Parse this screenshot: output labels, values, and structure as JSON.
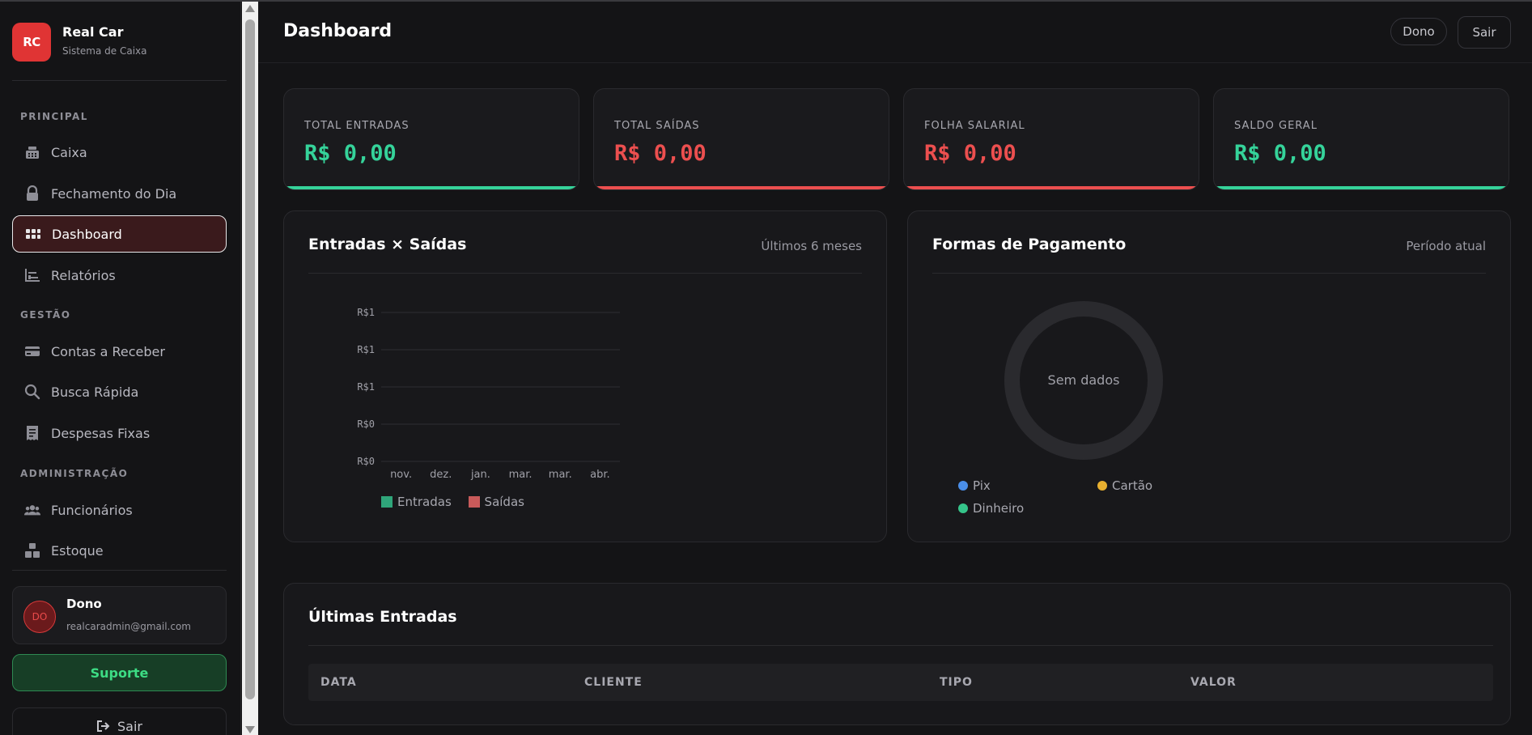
{
  "brand": {
    "logo_text": "RC",
    "name": "Real Car",
    "subtitle": "Sistema de Caixa"
  },
  "sidebar": {
    "sections": {
      "principal": "PRINCIPAL",
      "gestao": "GESTÃO",
      "admin": "ADMINISTRAÇÃO"
    },
    "items": [
      {
        "label": "Caixa",
        "icon": "cash-register-icon"
      },
      {
        "label": "Fechamento do Dia",
        "icon": "lock-icon"
      },
      {
        "label": "Dashboard",
        "icon": "grid-icon",
        "active": true
      },
      {
        "label": "Relatórios",
        "icon": "chart-icon"
      },
      {
        "label": "Contas a Receber",
        "icon": "credit-card-icon"
      },
      {
        "label": "Busca Rápida",
        "icon": "search-icon"
      },
      {
        "label": "Despesas Fixas",
        "icon": "receipt-icon"
      },
      {
        "label": "Funcionários",
        "icon": "users-icon"
      },
      {
        "label": "Estoque",
        "icon": "boxes-icon"
      }
    ]
  },
  "user": {
    "initials": "DO",
    "name": "Dono",
    "email": "realcaradmin@gmail.com"
  },
  "support_label": "Suporte",
  "logout_label": "Sair",
  "header": {
    "title": "Dashboard",
    "role_badge": "Dono",
    "logout": "Sair"
  },
  "stats": [
    {
      "label": "TOTAL ENTRADAS",
      "value": "R$ 0,00",
      "tone": "#35d39a"
    },
    {
      "label": "TOTAL SAÍDAS",
      "value": "R$ 0,00",
      "tone": "#ec4f4f"
    },
    {
      "label": "FOLHA SALARIAL",
      "value": "R$ 0,00",
      "tone": "#ec4f4f"
    },
    {
      "label": "SALDO GERAL",
      "value": "R$ 0,00",
      "tone": "#35d39a"
    }
  ],
  "bar_panel": {
    "title": "Entradas × Saídas",
    "note": "Últimos 6 meses"
  },
  "pie_panel": {
    "title": "Formas de Pagamento",
    "note": "Período atual",
    "empty": "Sem dados"
  },
  "table": {
    "title": "Últimas Entradas",
    "columns": [
      "DATA",
      "CLIENTE",
      "TIPO",
      "VALOR"
    ]
  },
  "chart_data": [
    {
      "type": "bar",
      "categories": [
        "nov.",
        "dez.",
        "jan.",
        "mar.",
        "mar.",
        "abr."
      ],
      "y_tick_labels": [
        "R$1",
        "R$1",
        "R$1",
        "R$0",
        "R$0"
      ],
      "series": [
        {
          "name": "Entradas",
          "values": [
            0,
            0,
            0,
            0,
            0,
            0
          ],
          "color": "#2fa57a"
        },
        {
          "name": "Saídas",
          "values": [
            0,
            0,
            0,
            0,
            0,
            0
          ],
          "color": "#c85a5a"
        }
      ],
      "grid": true,
      "legend": "bottom"
    },
    {
      "type": "pie",
      "labels": [
        "Pix",
        "Cartão",
        "Dinheiro"
      ],
      "values": [
        0,
        0,
        0
      ],
      "colors": [
        "#4a8ee8",
        "#e8b030",
        "#35c48a"
      ],
      "empty_label": "Sem dados",
      "legend": "bottom"
    }
  ]
}
